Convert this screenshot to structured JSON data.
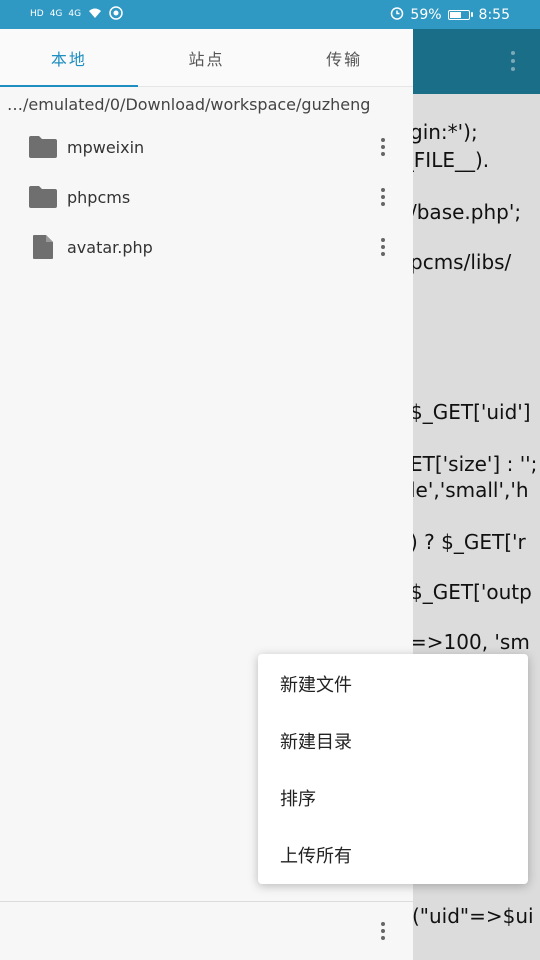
{
  "status_bar": {
    "network_left": "HD",
    "signal_1": "4G",
    "signal_2": "4G",
    "battery_percent": "59%",
    "battery_level": 0.59,
    "time": "8:55"
  },
  "drawer": {
    "tabs": [
      {
        "label": "本地"
      },
      {
        "label": "站点"
      },
      {
        "label": "传输"
      }
    ],
    "path": "…/emulated/0/Download/workspace/guzheng",
    "files": [
      {
        "name": "mpweixin",
        "icon": "folder-icon"
      },
      {
        "name": "phpcms",
        "icon": "folder-icon"
      },
      {
        "name": "avatar.php",
        "icon": "file-icon"
      }
    ]
  },
  "popup_menu": {
    "items": [
      {
        "label": "新建文件"
      },
      {
        "label": "新建目录"
      },
      {
        "label": "排序"
      },
      {
        "label": "上传所有"
      }
    ]
  },
  "editor": {
    "code_fragments": [
      "gin:*');",
      "(__FILE__).",
      "/base.php';",
      "pcms/libs/",
      "$_GET['uid']",
      "ET['size'] : '';",
      "le','small','h",
      ") ? $_GET['r",
      "$_GET['outp",
      "=>100, 'sm",
      "(\"uid\"=>$ui"
    ]
  },
  "colors": {
    "status_bar": "#2f98c3",
    "accent": "#1e8fc0",
    "editor_toolbar": "#1a6e88"
  }
}
